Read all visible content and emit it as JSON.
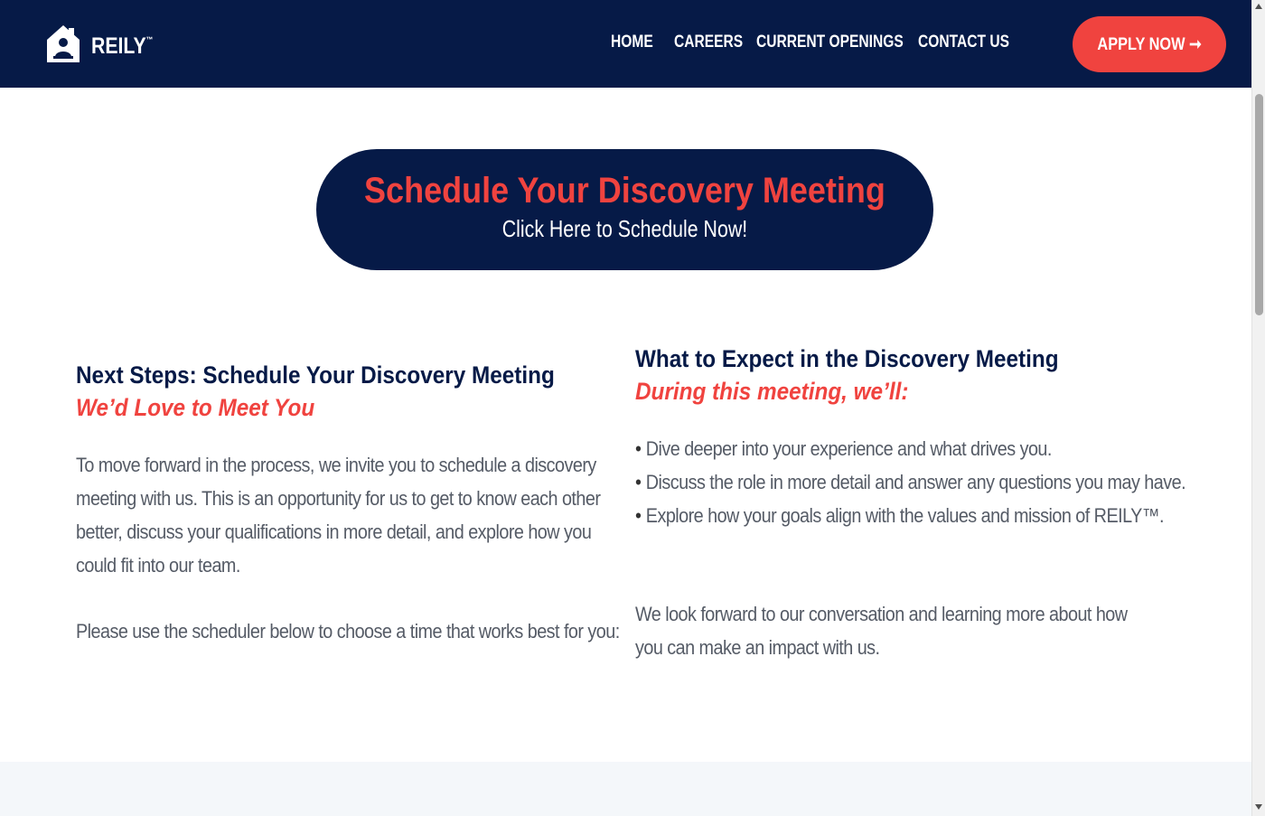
{
  "header": {
    "brand": "REILY",
    "brand_tm": "™",
    "nav": [
      "HOME",
      "CAREERS",
      "CURRENT OPENINGS",
      "CONTACT US"
    ],
    "apply_label": "APPLY NOW ➞"
  },
  "hero": {
    "title": "Schedule Your Discovery Meeting",
    "subtitle": "Click Here to Schedule Now!"
  },
  "left": {
    "heading": "Next Steps: Schedule Your Discovery Meeting",
    "subheading": "We’d Love to Meet You",
    "paragraph1": "To move forward in the process, we invite you to schedule a discovery meeting with us. This is an opportunity for us to get to know each other better, discuss your qualifications in more detail, and explore how you could fit into our team.",
    "paragraph2": "Please use the scheduler below to choose a time that works best for you:"
  },
  "right": {
    "heading": "What to Expect in the Discovery Meeting",
    "subheading": "During this meeting, we’ll:",
    "bullets": [
      "Dive deeper into your experience and what drives you.",
      "Discuss the role in more detail and answer any questions you may have.",
      "Explore how your goals align with the values and mission of REILY™."
    ],
    "closing": "We look forward to our conversation and learning more about how you can make an impact with us."
  },
  "colors": {
    "navy": "#061a47",
    "accent_red": "#f0433f",
    "body_text": "#555b66"
  },
  "icons": {
    "logo": "house-icon"
  }
}
